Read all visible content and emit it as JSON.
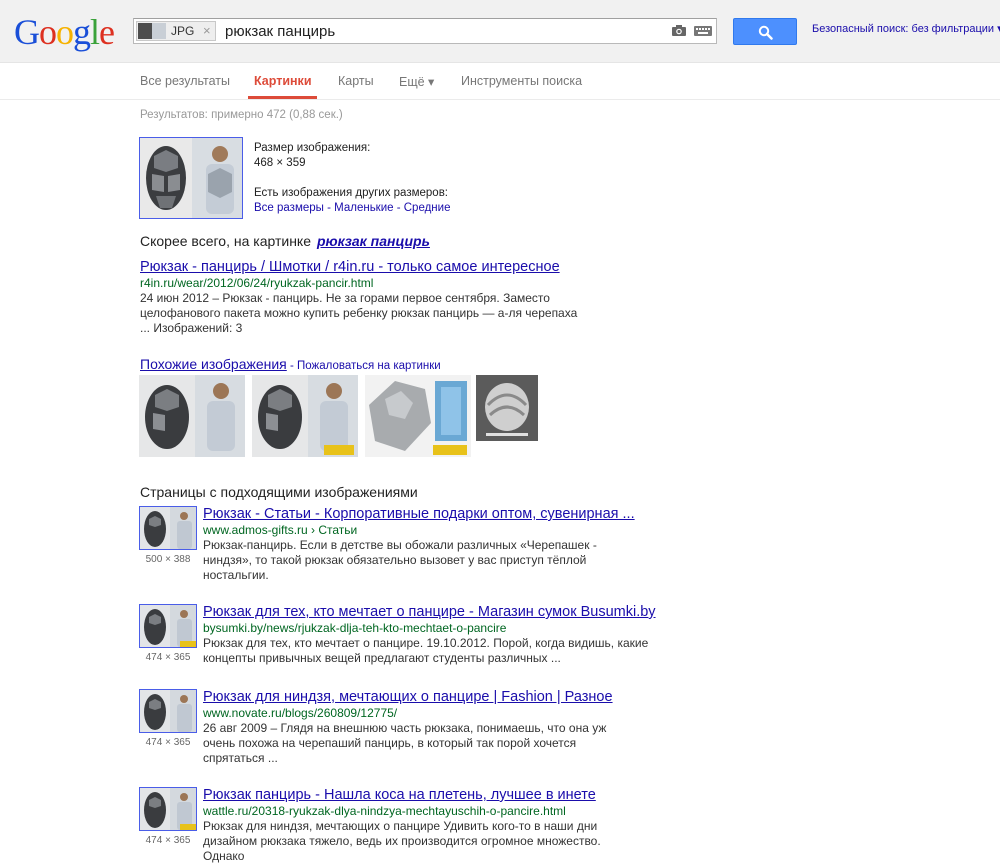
{
  "header": {
    "logo": [
      "G",
      "o",
      "o",
      "g",
      "l",
      "e"
    ],
    "logo_colors": [
      "#1a4fd8",
      "#dd3020",
      "#f6b200",
      "#1a4fd8",
      "#3aa23a",
      "#dd3020"
    ],
    "chip_label": "JPG",
    "chip_close": "×",
    "query": "рюкзак панцирь",
    "safe_search": "Безопасный поиск: без фильтрации ▾"
  },
  "nav": {
    "items": [
      "Все результаты",
      "Картинки",
      "Карты",
      "Ещё ▾",
      "Инструменты поиска"
    ],
    "active_index": 1
  },
  "stats": "Результатов: примерно 472 (0,88 сек.)",
  "image_info": {
    "size_label": "Размер изображения:",
    "size_value": "468 × 359",
    "other_sizes": "Есть изображения других размеров:",
    "links": "Все размеры - Маленькие - Средние"
  },
  "best_guess": {
    "label": "Скорее всего, на картинке",
    "query": "рюкзак панцирь"
  },
  "result1": {
    "title": "Рюкзак - панцирь / Шмотки / r4in.ru - только самое интересное",
    "url": "r4in.ru/wear/2012/06/24/ryukzak-pancir.html",
    "snippet1": "24 июн 2012 – Рюкзак - панцирь. Не за горами первое сентября. Заместо",
    "snippet2": "целофанового пакета можно купить ребенку рюкзак панцирь — а-ля черепаха",
    "snippet3": "... Изображений: 3"
  },
  "similar": {
    "title": "Похожие изображения",
    "sep": " - ",
    "report": "Пожаловаться на картинки"
  },
  "pages": {
    "heading": "Страницы с подходящими изображениями",
    "items": [
      {
        "title": "Рюкзак - Статьи - Корпоративные подарки оптом, сувенирная ...",
        "url": "www.admos-gifts.ru › Статьи",
        "snippet1": "Рюкзак-панцирь. Если в детстве вы обожали различных «Черепашек -",
        "snippet2": "ниндзя», то такой рюкзак обязательно вызовет у вас приступ тёплой",
        "snippet3": "ностальгии.",
        "dims": "500 × 388"
      },
      {
        "title": "Рюкзак для тех, кто мечтает о панцире - Магазин сумок Busumki.by",
        "url": "bysumki.by/news/rjukzak-dlja-teh-kto-mechtaet-o-pancire",
        "snippet1": "Рюкзак для тех, кто мечтает о панцире. 19.10.2012. Порой, когда видишь, какие",
        "snippet2": "концепты привычных вещей предлагают студенты различных ...",
        "snippet3": "",
        "dims": "474 × 365"
      },
      {
        "title": "Рюкзак для ниндзя, мечтающих о панцире | Fashion | Разное",
        "url": "www.novate.ru/blogs/260809/12775/",
        "snippet1": "26 авг 2009 – Глядя на внешнюю часть рюкзака, понимаешь, что она уж",
        "snippet2": "очень похожа на черепаший панцирь, в который так порой хочется",
        "snippet3": "спрятаться ...",
        "dims": "474 × 365"
      },
      {
        "title": "Рюкзак панцирь - Нашла коса на плетень, лучшее в инете",
        "url": "wattle.ru/20318-ryukzak-dlya-nindzya-mechtayuschih-o-pancire.html",
        "snippet1": "Рюкзак для ниндзя, мечтающих о панцире Удивить кого-то в наши дни",
        "snippet2": "дизайном рюкзака тяжело, ведь их производится огромное множество.",
        "snippet3": "Однако",
        "dims": "474 × 365"
      }
    ]
  }
}
